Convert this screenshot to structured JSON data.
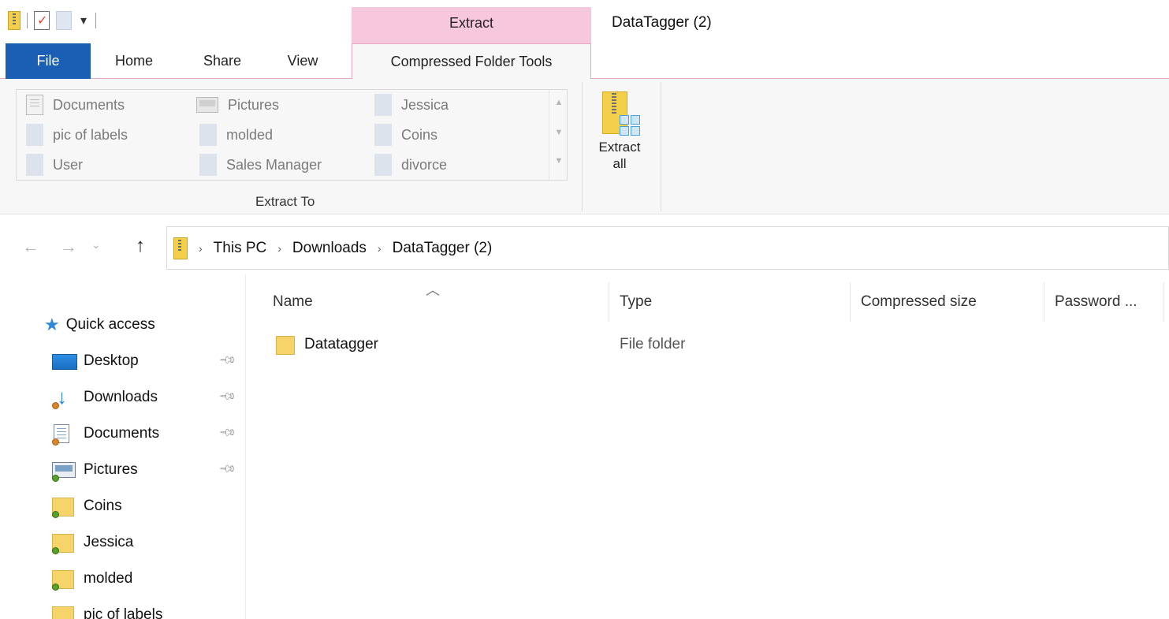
{
  "window": {
    "title": "DataTagger (2)",
    "context_tab_group": "Extract"
  },
  "tabs": {
    "file": "File",
    "home": "Home",
    "share": "Share",
    "view": "View",
    "active": "Compressed Folder Tools"
  },
  "ribbon": {
    "gallery": [
      {
        "label": "Documents",
        "icon": "documents-icon"
      },
      {
        "label": "Pictures",
        "icon": "pictures-icon"
      },
      {
        "label": "Jessica",
        "icon": "folder-icon"
      },
      {
        "label": "pic of labels",
        "icon": "folder-icon"
      },
      {
        "label": "molded",
        "icon": "folder-icon"
      },
      {
        "label": "Coins",
        "icon": "folder-icon"
      },
      {
        "label": "User",
        "icon": "folder-icon"
      },
      {
        "label": "Sales Manager",
        "icon": "folder-icon"
      },
      {
        "label": "divorce",
        "icon": "folder-icon"
      }
    ],
    "extract_to_label": "Extract To",
    "extract_all_line1": "Extract",
    "extract_all_line2": "all"
  },
  "address": {
    "crumbs": [
      "This PC",
      "Downloads",
      "DataTagger (2)"
    ],
    "separator": "›"
  },
  "nav": {
    "quick_access": "Quick access",
    "items": [
      {
        "label": "Desktop",
        "pinned": true,
        "icon": "desktop-icon"
      },
      {
        "label": "Downloads",
        "pinned": true,
        "icon": "downloads-icon"
      },
      {
        "label": "Documents",
        "pinned": true,
        "icon": "documents-icon"
      },
      {
        "label": "Pictures",
        "pinned": true,
        "icon": "pictures-icon"
      },
      {
        "label": "Coins",
        "pinned": false,
        "icon": "folder-icon"
      },
      {
        "label": "Jessica",
        "pinned": false,
        "icon": "folder-icon"
      },
      {
        "label": "molded",
        "pinned": false,
        "icon": "folder-icon"
      },
      {
        "label": "pic of labels",
        "pinned": false,
        "icon": "folder-icon"
      }
    ]
  },
  "filelist": {
    "columns": [
      "Name",
      "Type",
      "Compressed size",
      "Password ..."
    ],
    "rows": [
      {
        "name": "Datatagger",
        "type": "File folder",
        "icon": "folder-icon"
      }
    ]
  },
  "colors": {
    "file_tab": "#1a5fb4",
    "context_tab": "#f7c8dd",
    "quick_access_star": "#2f89d6"
  }
}
